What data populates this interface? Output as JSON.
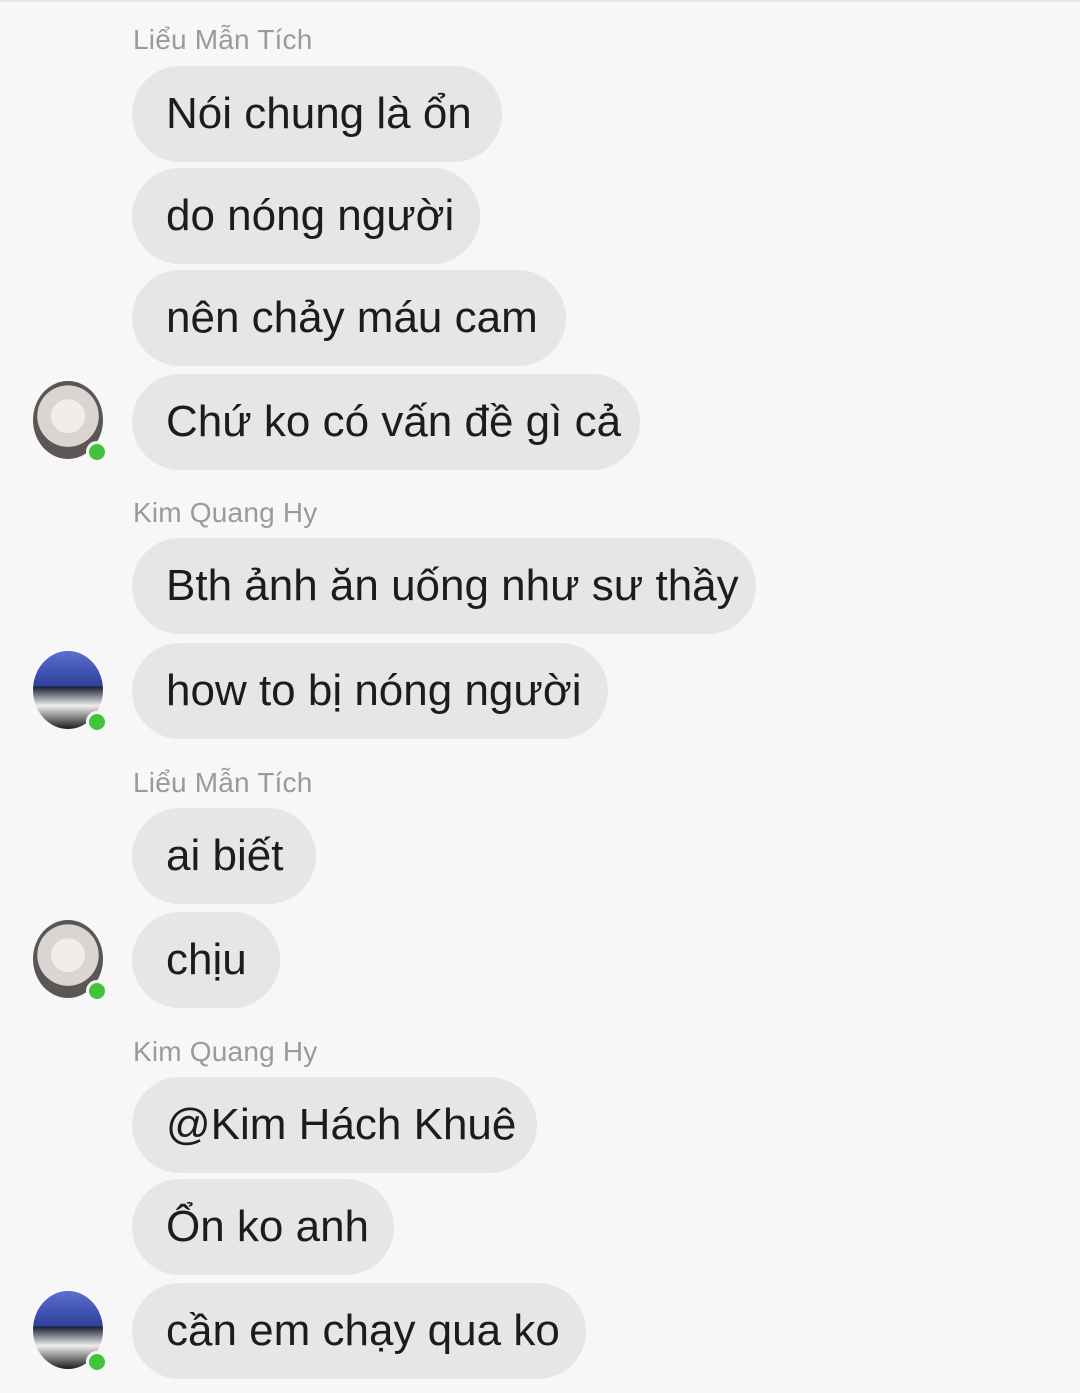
{
  "groups": [
    {
      "sender": "Liểu Mẫn Tích",
      "avatar": "avatar-light",
      "messages": [
        "Nói chung là ổn",
        "do nóng người",
        "nên chảy máu cam",
        "Chứ ko có vấn đề gì cả"
      ]
    },
    {
      "sender": "Kim Quang Hy",
      "avatar": "avatar-blue",
      "messages": [
        "Bth ảnh ăn uống như sư thầy",
        "how to bị nóng người"
      ]
    },
    {
      "sender": "Liểu Mẫn Tích",
      "avatar": "avatar-light",
      "messages": [
        "ai biết",
        "chịu"
      ]
    },
    {
      "sender": "Kim Quang Hy",
      "avatar": "avatar-blue",
      "messages": [
        "@Kim Hách Khuê",
        "Ổn ko anh",
        "cần em chạy qua ko"
      ]
    }
  ],
  "colors": {
    "bubble": "#e6e6e6",
    "background": "#f7f7f7",
    "online_dot": "#41c33c",
    "sender_name": "#9a9a9a"
  }
}
